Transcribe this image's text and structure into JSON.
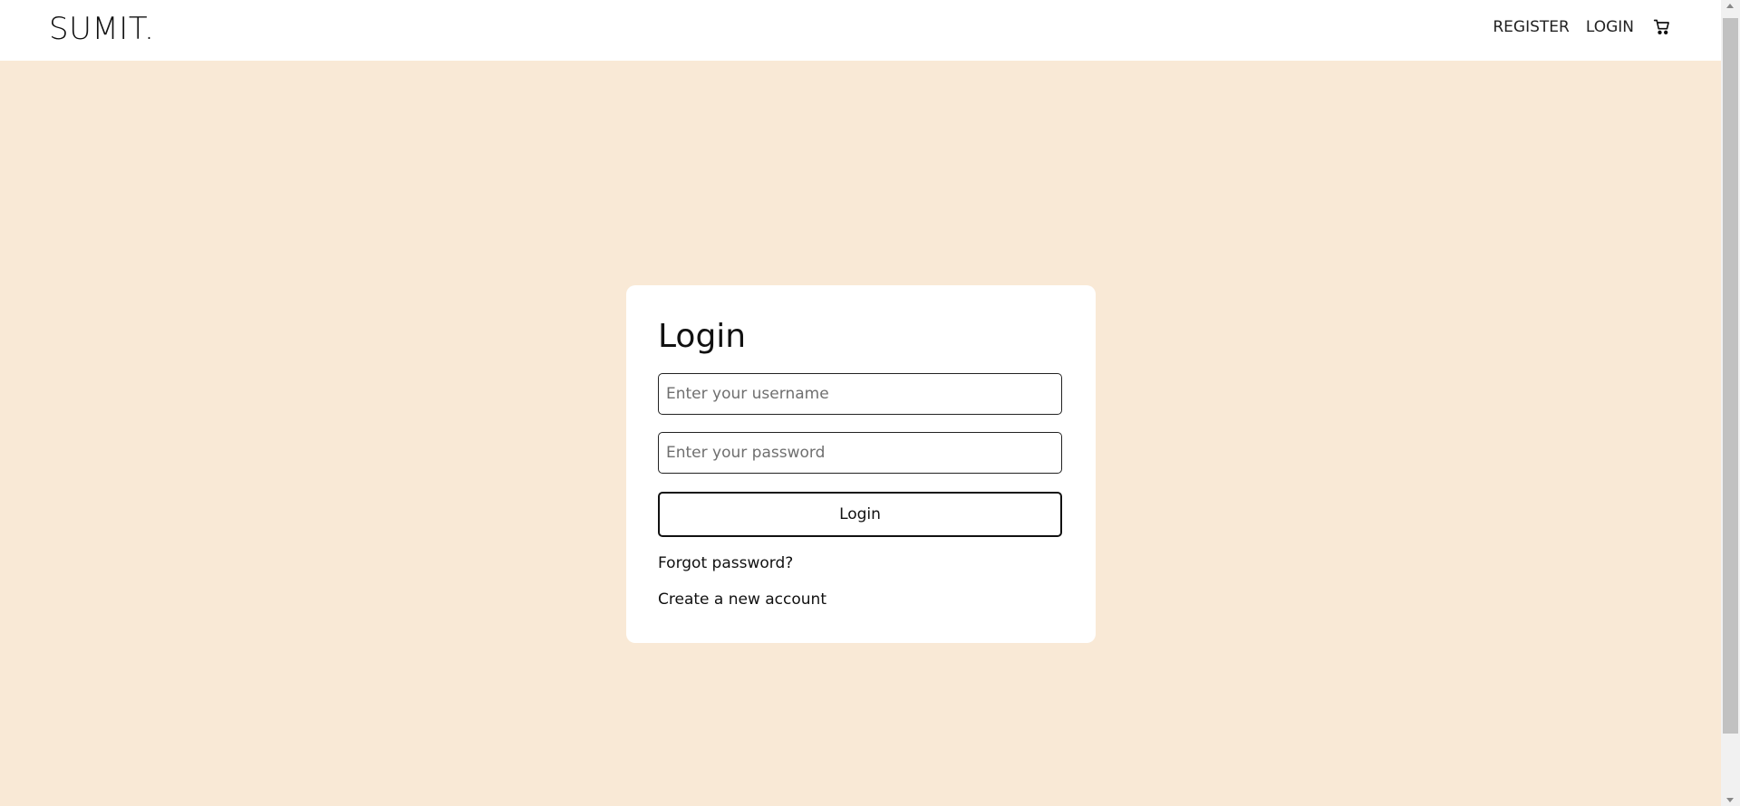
{
  "header": {
    "brand": "SUMIT.",
    "nav": {
      "register_label": "REGISTER",
      "login_label": "LOGIN",
      "cart_icon": "cart-icon"
    }
  },
  "login_form": {
    "title": "Login",
    "username": {
      "placeholder": "Enter your username",
      "value": ""
    },
    "password": {
      "placeholder": "Enter your password",
      "value": ""
    },
    "submit_label": "Login",
    "forgot_password_label": "Forgot password?",
    "create_account_label": "Create a new account"
  },
  "colors": {
    "page_background": "#f9e9d6",
    "card_background": "#ffffff",
    "navbar_background": "#ffffff",
    "text": "#111111"
  }
}
